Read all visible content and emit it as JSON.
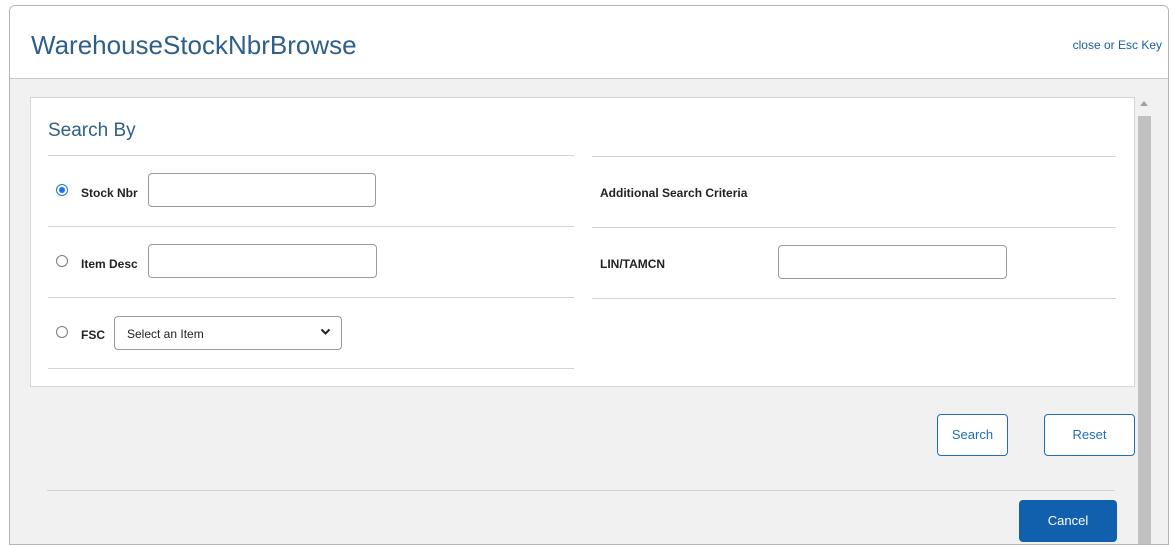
{
  "header": {
    "title": "WarehouseStockNbrBrowse",
    "close_label": "close or Esc Key"
  },
  "search": {
    "section_title": "Search By",
    "options": [
      {
        "label": "Stock Nbr",
        "selected": true,
        "value": ""
      },
      {
        "label": "Item Desc",
        "selected": false,
        "value": ""
      },
      {
        "label": "FSC",
        "selected": false,
        "select_value": "Select an Item"
      }
    ],
    "additional_title": "Additional Search Criteria",
    "lin_tamcn_label": "LIN/TAMCN",
    "lin_tamcn_value": ""
  },
  "actions": {
    "search_label": "Search",
    "reset_label": "Reset",
    "cancel_label": "Cancel"
  },
  "colors": {
    "title": "#2e5f8a",
    "link": "#1b5fa3",
    "primary": "#1160ad",
    "radio_checked": "#1a73e8"
  }
}
